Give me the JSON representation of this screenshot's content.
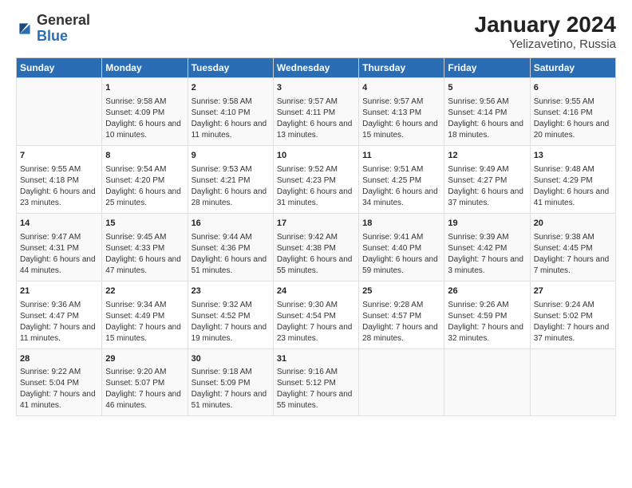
{
  "logo": {
    "general": "General",
    "blue": "Blue"
  },
  "title": "January 2024",
  "subtitle": "Yelizavetino, Russia",
  "days_header": [
    "Sunday",
    "Monday",
    "Tuesday",
    "Wednesday",
    "Thursday",
    "Friday",
    "Saturday"
  ],
  "weeks": [
    [
      {
        "day": "",
        "sunrise": "",
        "sunset": "",
        "daylight": ""
      },
      {
        "day": "1",
        "sunrise": "Sunrise: 9:58 AM",
        "sunset": "Sunset: 4:09 PM",
        "daylight": "Daylight: 6 hours and 10 minutes."
      },
      {
        "day": "2",
        "sunrise": "Sunrise: 9:58 AM",
        "sunset": "Sunset: 4:10 PM",
        "daylight": "Daylight: 6 hours and 11 minutes."
      },
      {
        "day": "3",
        "sunrise": "Sunrise: 9:57 AM",
        "sunset": "Sunset: 4:11 PM",
        "daylight": "Daylight: 6 hours and 13 minutes."
      },
      {
        "day": "4",
        "sunrise": "Sunrise: 9:57 AM",
        "sunset": "Sunset: 4:13 PM",
        "daylight": "Daylight: 6 hours and 15 minutes."
      },
      {
        "day": "5",
        "sunrise": "Sunrise: 9:56 AM",
        "sunset": "Sunset: 4:14 PM",
        "daylight": "Daylight: 6 hours and 18 minutes."
      },
      {
        "day": "6",
        "sunrise": "Sunrise: 9:55 AM",
        "sunset": "Sunset: 4:16 PM",
        "daylight": "Daylight: 6 hours and 20 minutes."
      }
    ],
    [
      {
        "day": "7",
        "sunrise": "Sunrise: 9:55 AM",
        "sunset": "Sunset: 4:18 PM",
        "daylight": "Daylight: 6 hours and 23 minutes."
      },
      {
        "day": "8",
        "sunrise": "Sunrise: 9:54 AM",
        "sunset": "Sunset: 4:20 PM",
        "daylight": "Daylight: 6 hours and 25 minutes."
      },
      {
        "day": "9",
        "sunrise": "Sunrise: 9:53 AM",
        "sunset": "Sunset: 4:21 PM",
        "daylight": "Daylight: 6 hours and 28 minutes."
      },
      {
        "day": "10",
        "sunrise": "Sunrise: 9:52 AM",
        "sunset": "Sunset: 4:23 PM",
        "daylight": "Daylight: 6 hours and 31 minutes."
      },
      {
        "day": "11",
        "sunrise": "Sunrise: 9:51 AM",
        "sunset": "Sunset: 4:25 PM",
        "daylight": "Daylight: 6 hours and 34 minutes."
      },
      {
        "day": "12",
        "sunrise": "Sunrise: 9:49 AM",
        "sunset": "Sunset: 4:27 PM",
        "daylight": "Daylight: 6 hours and 37 minutes."
      },
      {
        "day": "13",
        "sunrise": "Sunrise: 9:48 AM",
        "sunset": "Sunset: 4:29 PM",
        "daylight": "Daylight: 6 hours and 41 minutes."
      }
    ],
    [
      {
        "day": "14",
        "sunrise": "Sunrise: 9:47 AM",
        "sunset": "Sunset: 4:31 PM",
        "daylight": "Daylight: 6 hours and 44 minutes."
      },
      {
        "day": "15",
        "sunrise": "Sunrise: 9:45 AM",
        "sunset": "Sunset: 4:33 PM",
        "daylight": "Daylight: 6 hours and 47 minutes."
      },
      {
        "day": "16",
        "sunrise": "Sunrise: 9:44 AM",
        "sunset": "Sunset: 4:36 PM",
        "daylight": "Daylight: 6 hours and 51 minutes."
      },
      {
        "day": "17",
        "sunrise": "Sunrise: 9:42 AM",
        "sunset": "Sunset: 4:38 PM",
        "daylight": "Daylight: 6 hours and 55 minutes."
      },
      {
        "day": "18",
        "sunrise": "Sunrise: 9:41 AM",
        "sunset": "Sunset: 4:40 PM",
        "daylight": "Daylight: 6 hours and 59 minutes."
      },
      {
        "day": "19",
        "sunrise": "Sunrise: 9:39 AM",
        "sunset": "Sunset: 4:42 PM",
        "daylight": "Daylight: 7 hours and 3 minutes."
      },
      {
        "day": "20",
        "sunrise": "Sunrise: 9:38 AM",
        "sunset": "Sunset: 4:45 PM",
        "daylight": "Daylight: 7 hours and 7 minutes."
      }
    ],
    [
      {
        "day": "21",
        "sunrise": "Sunrise: 9:36 AM",
        "sunset": "Sunset: 4:47 PM",
        "daylight": "Daylight: 7 hours and 11 minutes."
      },
      {
        "day": "22",
        "sunrise": "Sunrise: 9:34 AM",
        "sunset": "Sunset: 4:49 PM",
        "daylight": "Daylight: 7 hours and 15 minutes."
      },
      {
        "day": "23",
        "sunrise": "Sunrise: 9:32 AM",
        "sunset": "Sunset: 4:52 PM",
        "daylight": "Daylight: 7 hours and 19 minutes."
      },
      {
        "day": "24",
        "sunrise": "Sunrise: 9:30 AM",
        "sunset": "Sunset: 4:54 PM",
        "daylight": "Daylight: 7 hours and 23 minutes."
      },
      {
        "day": "25",
        "sunrise": "Sunrise: 9:28 AM",
        "sunset": "Sunset: 4:57 PM",
        "daylight": "Daylight: 7 hours and 28 minutes."
      },
      {
        "day": "26",
        "sunrise": "Sunrise: 9:26 AM",
        "sunset": "Sunset: 4:59 PM",
        "daylight": "Daylight: 7 hours and 32 minutes."
      },
      {
        "day": "27",
        "sunrise": "Sunrise: 9:24 AM",
        "sunset": "Sunset: 5:02 PM",
        "daylight": "Daylight: 7 hours and 37 minutes."
      }
    ],
    [
      {
        "day": "28",
        "sunrise": "Sunrise: 9:22 AM",
        "sunset": "Sunset: 5:04 PM",
        "daylight": "Daylight: 7 hours and 41 minutes."
      },
      {
        "day": "29",
        "sunrise": "Sunrise: 9:20 AM",
        "sunset": "Sunset: 5:07 PM",
        "daylight": "Daylight: 7 hours and 46 minutes."
      },
      {
        "day": "30",
        "sunrise": "Sunrise: 9:18 AM",
        "sunset": "Sunset: 5:09 PM",
        "daylight": "Daylight: 7 hours and 51 minutes."
      },
      {
        "day": "31",
        "sunrise": "Sunrise: 9:16 AM",
        "sunset": "Sunset: 5:12 PM",
        "daylight": "Daylight: 7 hours and 55 minutes."
      },
      {
        "day": "",
        "sunrise": "",
        "sunset": "",
        "daylight": ""
      },
      {
        "day": "",
        "sunrise": "",
        "sunset": "",
        "daylight": ""
      },
      {
        "day": "",
        "sunrise": "",
        "sunset": "",
        "daylight": ""
      }
    ]
  ]
}
